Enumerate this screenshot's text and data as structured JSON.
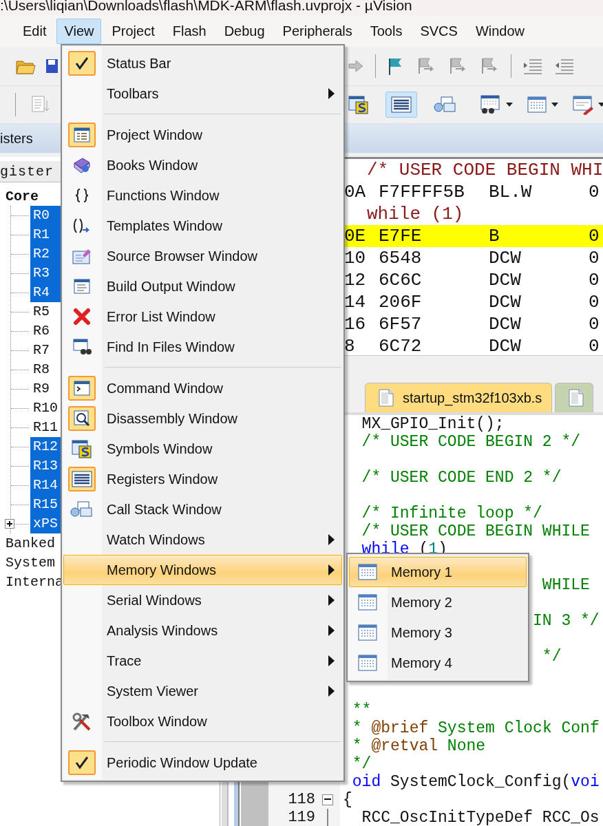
{
  "window": {
    "title": ":\\Users\\liqian\\Downloads\\flash\\MDK-ARM\\flash.uvprojx - µVision"
  },
  "menubar": [
    {
      "label": "Edit",
      "selected": false
    },
    {
      "label": "View",
      "selected": true
    },
    {
      "label": "Project",
      "selected": false
    },
    {
      "label": "Flash",
      "selected": false
    },
    {
      "label": "Debug",
      "selected": false
    },
    {
      "label": "Peripherals",
      "selected": false
    },
    {
      "label": "Tools",
      "selected": false
    },
    {
      "label": "SVCS",
      "selected": false
    },
    {
      "label": "Window",
      "selected": false
    }
  ],
  "toolbar_1": {
    "left": [
      {
        "kind": "folder",
        "disabled": false
      },
      {
        "kind": "save",
        "disabled": false
      }
    ],
    "right": [
      {
        "kind": "arrow",
        "disabled": true
      },
      {
        "kind": "separator"
      },
      {
        "kind": "flag",
        "disabled": false
      },
      {
        "kind": "bookmark-prev",
        "disabled": true
      },
      {
        "kind": "bookmark-next",
        "disabled": true
      },
      {
        "kind": "bookmark-clear",
        "disabled": true
      },
      {
        "kind": "separator"
      },
      {
        "kind": "indent",
        "disabled": false
      },
      {
        "kind": "outdent",
        "disabled": false
      }
    ]
  },
  "toolbar_2": {
    "left": [
      {
        "kind": "separator"
      },
      {
        "kind": "document",
        "on": false,
        "dropdown": false
      }
    ],
    "right": [
      {
        "kind": "symbols",
        "on": false,
        "dropdown": false
      },
      {
        "kind": "registers",
        "on": true,
        "dropdown": false
      },
      {
        "kind": "stack",
        "on": false,
        "dropdown": false
      },
      {
        "kind": "watch",
        "on": false,
        "dropdown": true
      },
      {
        "kind": "memory",
        "on": false,
        "dropdown": true
      },
      {
        "kind": "serial",
        "on": false,
        "dropdown": true
      }
    ]
  },
  "registers_panel": {
    "tab": "isters",
    "column_header": "gister",
    "tree": [
      {
        "label": "Core",
        "children": [
          {
            "label": "R0",
            "kind": "register",
            "selected": true
          },
          {
            "label": "R1",
            "kind": "register",
            "selected": true
          },
          {
            "label": "R2",
            "kind": "register",
            "selected": true
          },
          {
            "label": "R3",
            "kind": "register",
            "selected": true
          },
          {
            "label": "R4",
            "kind": "register",
            "selected": true
          },
          {
            "label": "R5",
            "kind": "register",
            "selected": false
          },
          {
            "label": "R6",
            "kind": "register",
            "selected": false
          },
          {
            "label": "R7",
            "kind": "register",
            "selected": false
          },
          {
            "label": "R8",
            "kind": "register",
            "selected": false
          },
          {
            "label": "R9",
            "kind": "register",
            "selected": false
          },
          {
            "label": "R10",
            "kind": "register",
            "selected": false
          },
          {
            "label": "R11",
            "kind": "register",
            "selected": false
          },
          {
            "label": "R12",
            "kind": "register",
            "selected": true
          },
          {
            "label": "R13",
            "kind": "register",
            "selected": true
          },
          {
            "label": "R14",
            "kind": "register",
            "selected": true
          },
          {
            "label": "R15",
            "kind": "register",
            "selected": true
          },
          {
            "label": "xPS",
            "kind": "group",
            "selected": true,
            "expanded": false
          }
        ]
      },
      {
        "label": "Banked"
      },
      {
        "label": "System"
      },
      {
        "label": "Interna"
      }
    ]
  },
  "disassembly": [
    {
      "kind": "source",
      "text": "/* USER CODE BEGIN WHI"
    },
    {
      "kind": "instruction",
      "current": false,
      "address": "0A",
      "code": "F7FFFF5B",
      "mnemonic": "BL.W",
      "operand": "0"
    },
    {
      "kind": "source",
      "text": "while (1)"
    },
    {
      "kind": "instruction",
      "current": true,
      "address": "0E",
      "code": "E7FE",
      "mnemonic": "B",
      "operand": "0"
    },
    {
      "kind": "instruction",
      "current": false,
      "address": "10",
      "code": "6548",
      "mnemonic": "DCW",
      "operand": "0"
    },
    {
      "kind": "instruction",
      "current": false,
      "address": "12",
      "code": "6C6C",
      "mnemonic": "DCW",
      "operand": "0"
    },
    {
      "kind": "instruction",
      "current": false,
      "address": "14",
      "code": "206F",
      "mnemonic": "DCW",
      "operand": "0"
    },
    {
      "kind": "instruction",
      "current": false,
      "address": "16",
      "code": "6F57",
      "mnemonic": "DCW",
      "operand": "0"
    },
    {
      "kind": "instruction",
      "current": false,
      "address": "8",
      "code": "6C72",
      "mnemonic": "DCW",
      "operand": "0"
    }
  ],
  "editor_tabs": [
    {
      "label": "startup_stm32f103xb.s",
      "selected": true
    },
    {
      "selected": false
    }
  ],
  "editor": [
    {
      "kind": "code",
      "segments": [
        {
          "kind": "plain",
          "text": "  MX_GPIO_Init();"
        }
      ]
    },
    {
      "kind": "code",
      "segments": [
        {
          "kind": "comment",
          "text": "  /* USER CODE BEGIN 2 */"
        }
      ]
    },
    {
      "kind": "blank"
    },
    {
      "kind": "code",
      "segments": [
        {
          "kind": "comment",
          "text": "  /* USER CODE END 2 */"
        }
      ]
    },
    {
      "kind": "blank"
    },
    {
      "kind": "code",
      "segments": [
        {
          "kind": "comment",
          "text": "  /* Infinite loop */"
        }
      ]
    },
    {
      "kind": "code",
      "segments": [
        {
          "kind": "comment",
          "text": "  /* USER CODE BEGIN WHILE"
        }
      ]
    },
    {
      "kind": "code",
      "segments": [
        {
          "kind": "keyword",
          "text": "  while"
        },
        {
          "kind": "plain",
          "text": " ("
        },
        {
          "kind": "number",
          "text": "1"
        },
        {
          "kind": "plain",
          "text": ")"
        }
      ]
    },
    {
      "kind": "blank"
    },
    {
      "kind": "code",
      "segments": [
        {
          "kind": "comment",
          "text": "                     WHILE"
        }
      ]
    },
    {
      "kind": "blank"
    },
    {
      "kind": "code",
      "segments": [
        {
          "kind": "comment",
          "text": "                    IN 3 */"
        }
      ]
    },
    {
      "kind": "blank"
    },
    {
      "kind": "code",
      "segments": [
        {
          "kind": "comment",
          "text": "                     */"
        }
      ]
    },
    {
      "kind": "blank"
    },
    {
      "kind": "blank"
    },
    {
      "kind": "code",
      "segments": [
        {
          "kind": "comment",
          "text": " **"
        }
      ]
    },
    {
      "kind": "code",
      "segments": [
        {
          "kind": "comment",
          "text": " * "
        },
        {
          "kind": "tag",
          "text": "@brief"
        },
        {
          "kind": "comment",
          "text": " System Clock Conf"
        }
      ]
    },
    {
      "kind": "code",
      "segments": [
        {
          "kind": "comment",
          "text": " * "
        },
        {
          "kind": "tag",
          "text": "@retval"
        },
        {
          "kind": "comment",
          "text": " None"
        }
      ]
    },
    {
      "kind": "code",
      "segments": [
        {
          "kind": "comment",
          "text": " */"
        }
      ]
    },
    {
      "kind": "code",
      "segments": [
        {
          "kind": "keyword",
          "text": " oid"
        },
        {
          "kind": "plain",
          "text": " SystemClock_Config("
        },
        {
          "kind": "keyword",
          "text": "voi"
        }
      ]
    },
    {
      "kind": "code",
      "line_number": "118",
      "collapsed": false,
      "segments": [
        {
          "kind": "plain",
          "text": "{"
        }
      ]
    },
    {
      "kind": "code",
      "line_number": "119",
      "segments": [
        {
          "kind": "plain",
          "text": "  RCC_OscInitTypeDef RCC_Os"
        }
      ]
    }
  ],
  "view_menu": [
    {
      "kind": "item",
      "label": "Status Bar",
      "on": true,
      "submenu": false,
      "selected": false
    },
    {
      "kind": "item",
      "label": "Toolbars",
      "on": false,
      "submenu": true,
      "selected": false
    },
    {
      "kind": "separator"
    },
    {
      "kind": "item",
      "label": "Project Window",
      "on": true,
      "submenu": false,
      "selected": false
    },
    {
      "kind": "item",
      "label": "Books Window",
      "on": false,
      "submenu": false,
      "selected": false
    },
    {
      "kind": "item",
      "label": "Functions Window",
      "on": false,
      "submenu": false,
      "selected": false
    },
    {
      "kind": "item",
      "label": "Templates Window",
      "on": false,
      "submenu": false,
      "selected": false
    },
    {
      "kind": "item",
      "label": "Source Browser Window",
      "on": false,
      "submenu": false,
      "selected": false
    },
    {
      "kind": "item",
      "label": "Build Output Window",
      "on": false,
      "submenu": false,
      "selected": false
    },
    {
      "kind": "item",
      "label": "Error List Window",
      "on": false,
      "submenu": false,
      "selected": false
    },
    {
      "kind": "item",
      "label": "Find In Files Window",
      "on": false,
      "submenu": false,
      "selected": false
    },
    {
      "kind": "separator"
    },
    {
      "kind": "item",
      "label": "Command Window",
      "on": true,
      "submenu": false,
      "selected": false
    },
    {
      "kind": "item",
      "label": "Disassembly Window",
      "on": true,
      "submenu": false,
      "selected": false
    },
    {
      "kind": "item",
      "label": "Symbols Window",
      "on": false,
      "submenu": false,
      "selected": false
    },
    {
      "kind": "item",
      "label": "Registers Window",
      "on": true,
      "submenu": false,
      "selected": false
    },
    {
      "kind": "item",
      "label": "Call Stack Window",
      "on": false,
      "submenu": false,
      "selected": false
    },
    {
      "kind": "item",
      "label": "Watch Windows",
      "on": false,
      "submenu": true,
      "selected": false
    },
    {
      "kind": "item",
      "label": "Memory Windows",
      "on": false,
      "submenu": true,
      "selected": true
    },
    {
      "kind": "item",
      "label": "Serial Windows",
      "on": false,
      "submenu": true,
      "selected": false
    },
    {
      "kind": "item",
      "label": "Analysis Windows",
      "on": false,
      "submenu": true,
      "selected": false
    },
    {
      "kind": "item",
      "label": "Trace",
      "on": false,
      "submenu": true,
      "selected": false
    },
    {
      "kind": "item",
      "label": "System Viewer",
      "on": false,
      "submenu": true,
      "selected": false
    },
    {
      "kind": "item",
      "label": "Toolbox Window",
      "on": false,
      "submenu": false,
      "selected": false
    },
    {
      "kind": "separator"
    },
    {
      "kind": "item",
      "label": "Periodic Window Update",
      "on": true,
      "submenu": false,
      "selected": false
    }
  ],
  "memory_submenu": [
    {
      "label": "Memory 1",
      "selected": true
    },
    {
      "label": "Memory 2",
      "selected": false
    },
    {
      "label": "Memory 3",
      "selected": false
    },
    {
      "label": "Memory 4",
      "selected": false
    }
  ]
}
